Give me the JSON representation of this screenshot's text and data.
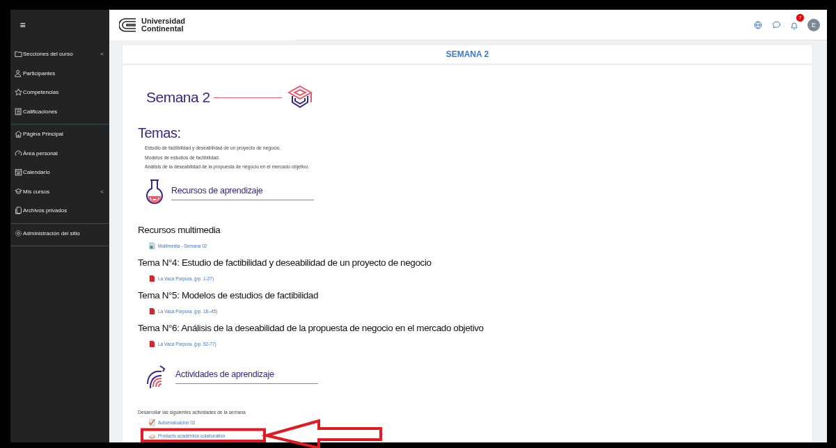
{
  "header": {
    "menu_icon": "≡",
    "logo": [
      "Universidad",
      "Continental"
    ],
    "notification_count": "7",
    "avatar": "E"
  },
  "sidebar": {
    "groups": [
      [
        {
          "label": "Secciones del curso",
          "kind": "folder",
          "chevron": "<"
        },
        {
          "label": "Participantes",
          "kind": "people"
        },
        {
          "label": "Competencias",
          "kind": "star"
        },
        {
          "label": "Calificaciones",
          "kind": "book"
        }
      ],
      [
        {
          "label": "Página Principal",
          "kind": "home"
        },
        {
          "label": "Área personal",
          "kind": "gauge"
        },
        {
          "label": "Calendario",
          "kind": "calendar"
        },
        {
          "label": "Mis cursos",
          "kind": "cap",
          "chevron": "<"
        },
        {
          "label": "Archivos privados",
          "kind": "files"
        }
      ],
      [
        {
          "label": "Administración del sitio",
          "kind": "gear"
        }
      ]
    ]
  },
  "section": {
    "title": "SEMANA 2",
    "heading": "Semana 2",
    "topics_title": "Temas:",
    "topics": [
      "Estudio de factibilidad y deseabilidad de un proyecto de negocio.",
      "Modelos de estudios de factibilidad.",
      "Análisis de la deseabilidad de la propuesta de negocio en el mercado objetivo."
    ],
    "resources_heading": "Recursos de aprendizaje",
    "resource_groups": [
      {
        "title": "Recursos multimedia",
        "links": [
          {
            "label": "Multimedia - Semana 02",
            "kind": "page"
          }
        ]
      },
      {
        "title": "Tema N°4: Estudio de factibilidad y deseabilidad de un proyecto de negocio",
        "links": [
          {
            "label": "La Vaca Púrpura. (pp. 1-27)",
            "kind": "pdf"
          }
        ]
      },
      {
        "title": "Tema N°5: Modelos de estudios de factibilidad",
        "links": [
          {
            "label": "La Vaca Púrpura. (pp. 18–45)",
            "kind": "pdf"
          }
        ]
      },
      {
        "title": "Tema N°6: Análisis de la deseabilidad de la propuesta de negocio en el mercado objetivo",
        "links": [
          {
            "label": "La Vaca Púrpura. (pp. 52-77)",
            "kind": "pdf"
          }
        ]
      }
    ],
    "activities_heading": "Actividades de aprendizaje",
    "activities_intro": "Desarrollar las siguientes actividades de la semana",
    "activities": [
      {
        "label": "Autoevaluación 02",
        "kind": "quiz"
      },
      {
        "label": "Producto académico colaborativo",
        "kind": "assignment"
      }
    ]
  }
}
